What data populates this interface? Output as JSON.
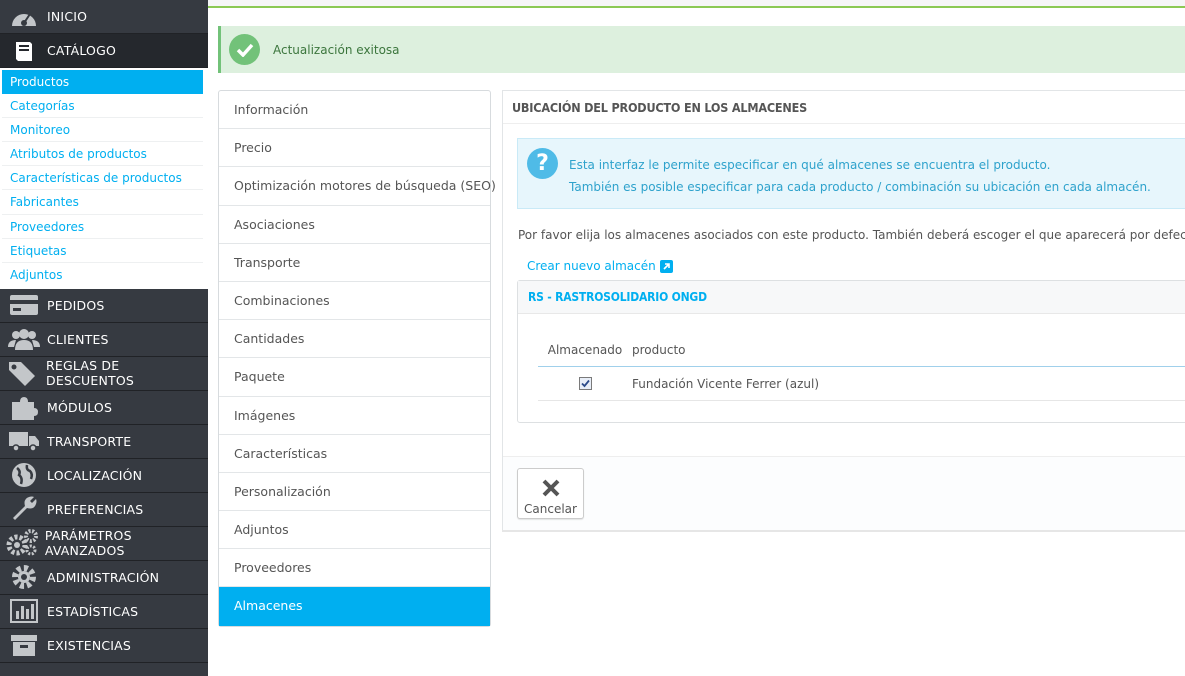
{
  "sidebar": {
    "top": [
      {
        "label": "INICIO",
        "icon": "dashboard-icon"
      },
      {
        "label": "CATÁLOGO",
        "icon": "book-icon"
      }
    ],
    "catalog_sub": [
      "Productos",
      "Categorías",
      "Monitoreo",
      "Atributos de productos",
      "Características de productos",
      "Fabricantes",
      "Proveedores",
      "Etiquetas",
      "Adjuntos"
    ],
    "bottom": [
      {
        "label": "PEDIDOS",
        "icon": "credit-card-icon"
      },
      {
        "label": "CLIENTES",
        "icon": "users-icon"
      },
      {
        "label": "REGLAS DE DESCUENTOS",
        "icon": "tags-icon"
      },
      {
        "label": "MÓDULOS",
        "icon": "puzzle-icon"
      },
      {
        "label": "TRANSPORTE",
        "icon": "truck-icon"
      },
      {
        "label": "LOCALIZACIÓN",
        "icon": "globe-icon"
      },
      {
        "label": "PREFERENCIAS",
        "icon": "wrench-icon"
      },
      {
        "label": "PARÁMETROS AVANZADOS",
        "icon": "cogs-icon"
      },
      {
        "label": "ADMINISTRACIÓN",
        "icon": "cog-icon"
      },
      {
        "label": "ESTADÍSTICAS",
        "icon": "bar-chart-icon"
      },
      {
        "label": "EXISTENCIAS",
        "icon": "archive-icon"
      }
    ]
  },
  "alert": {
    "message": "Actualización exitosa"
  },
  "tabs": [
    "Información",
    "Precio",
    "Optimización motores de búsqueda (SEO)",
    "Asociaciones",
    "Transporte",
    "Combinaciones",
    "Cantidades",
    "Paquete",
    "Imágenes",
    "Características",
    "Personalización",
    "Adjuntos",
    "Proveedores",
    "Almacenes"
  ],
  "panel": {
    "title": "UBICACIÓN DEL PRODUCTO EN LOS ALMACENES",
    "info_line1": "Esta interfaz le permite especificar en qué almacenes se encuentra el producto.",
    "info_line2": "También es posible especificar para cada producto / combinación su ubicación en cada almacén.",
    "intro": "Por favor elija los almacenes asociados con este producto. También deberá escoger el que aparecerá por defecto.",
    "create_link": "Crear nuevo almacén",
    "warehouse": {
      "name": "RS - RASTROSOLIDARIO ONGD",
      "col_stored": "Almacenado",
      "col_product": "producto",
      "rows": [
        {
          "checked": true,
          "product": "Fundación Vicente Ferrer (azul)"
        }
      ]
    },
    "cancel_label": "Cancelar"
  },
  "colors": {
    "accent": "#00aff0",
    "success": "#72c279",
    "sidebar_bg": "#363a41"
  }
}
